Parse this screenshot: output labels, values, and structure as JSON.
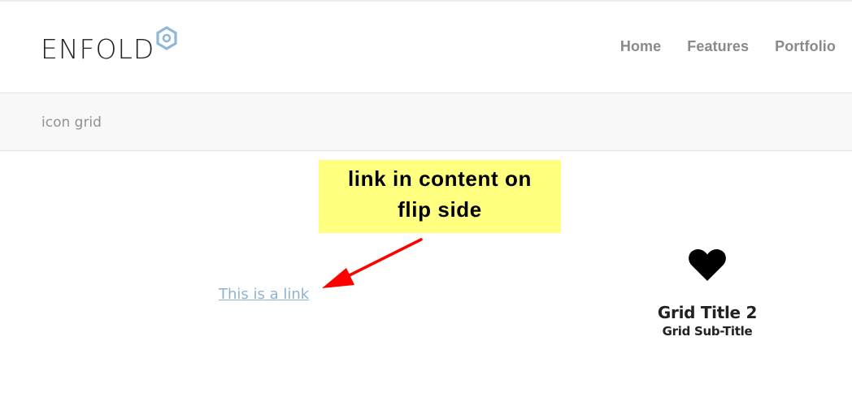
{
  "header": {
    "logo_text": "ENFOLD",
    "nav": [
      {
        "label": "Home"
      },
      {
        "label": "Features"
      },
      {
        "label": "Portfolio"
      }
    ]
  },
  "title_bar": {
    "page_title": "icon grid"
  },
  "annotation": {
    "callout_line1": "link in content on",
    "callout_line2": "flip side",
    "background_color": "#ffff80",
    "arrow_color": "#ff0000"
  },
  "content": {
    "link_text": "This is a link",
    "link_color": "#8fb3cf"
  },
  "icon_grid": {
    "icon": "heart-icon",
    "title": "Grid Title 2",
    "subtitle": "Grid Sub-Title"
  },
  "colors": {
    "logo_accent": "#8fb8d8",
    "nav_text": "#8a8a8a"
  }
}
